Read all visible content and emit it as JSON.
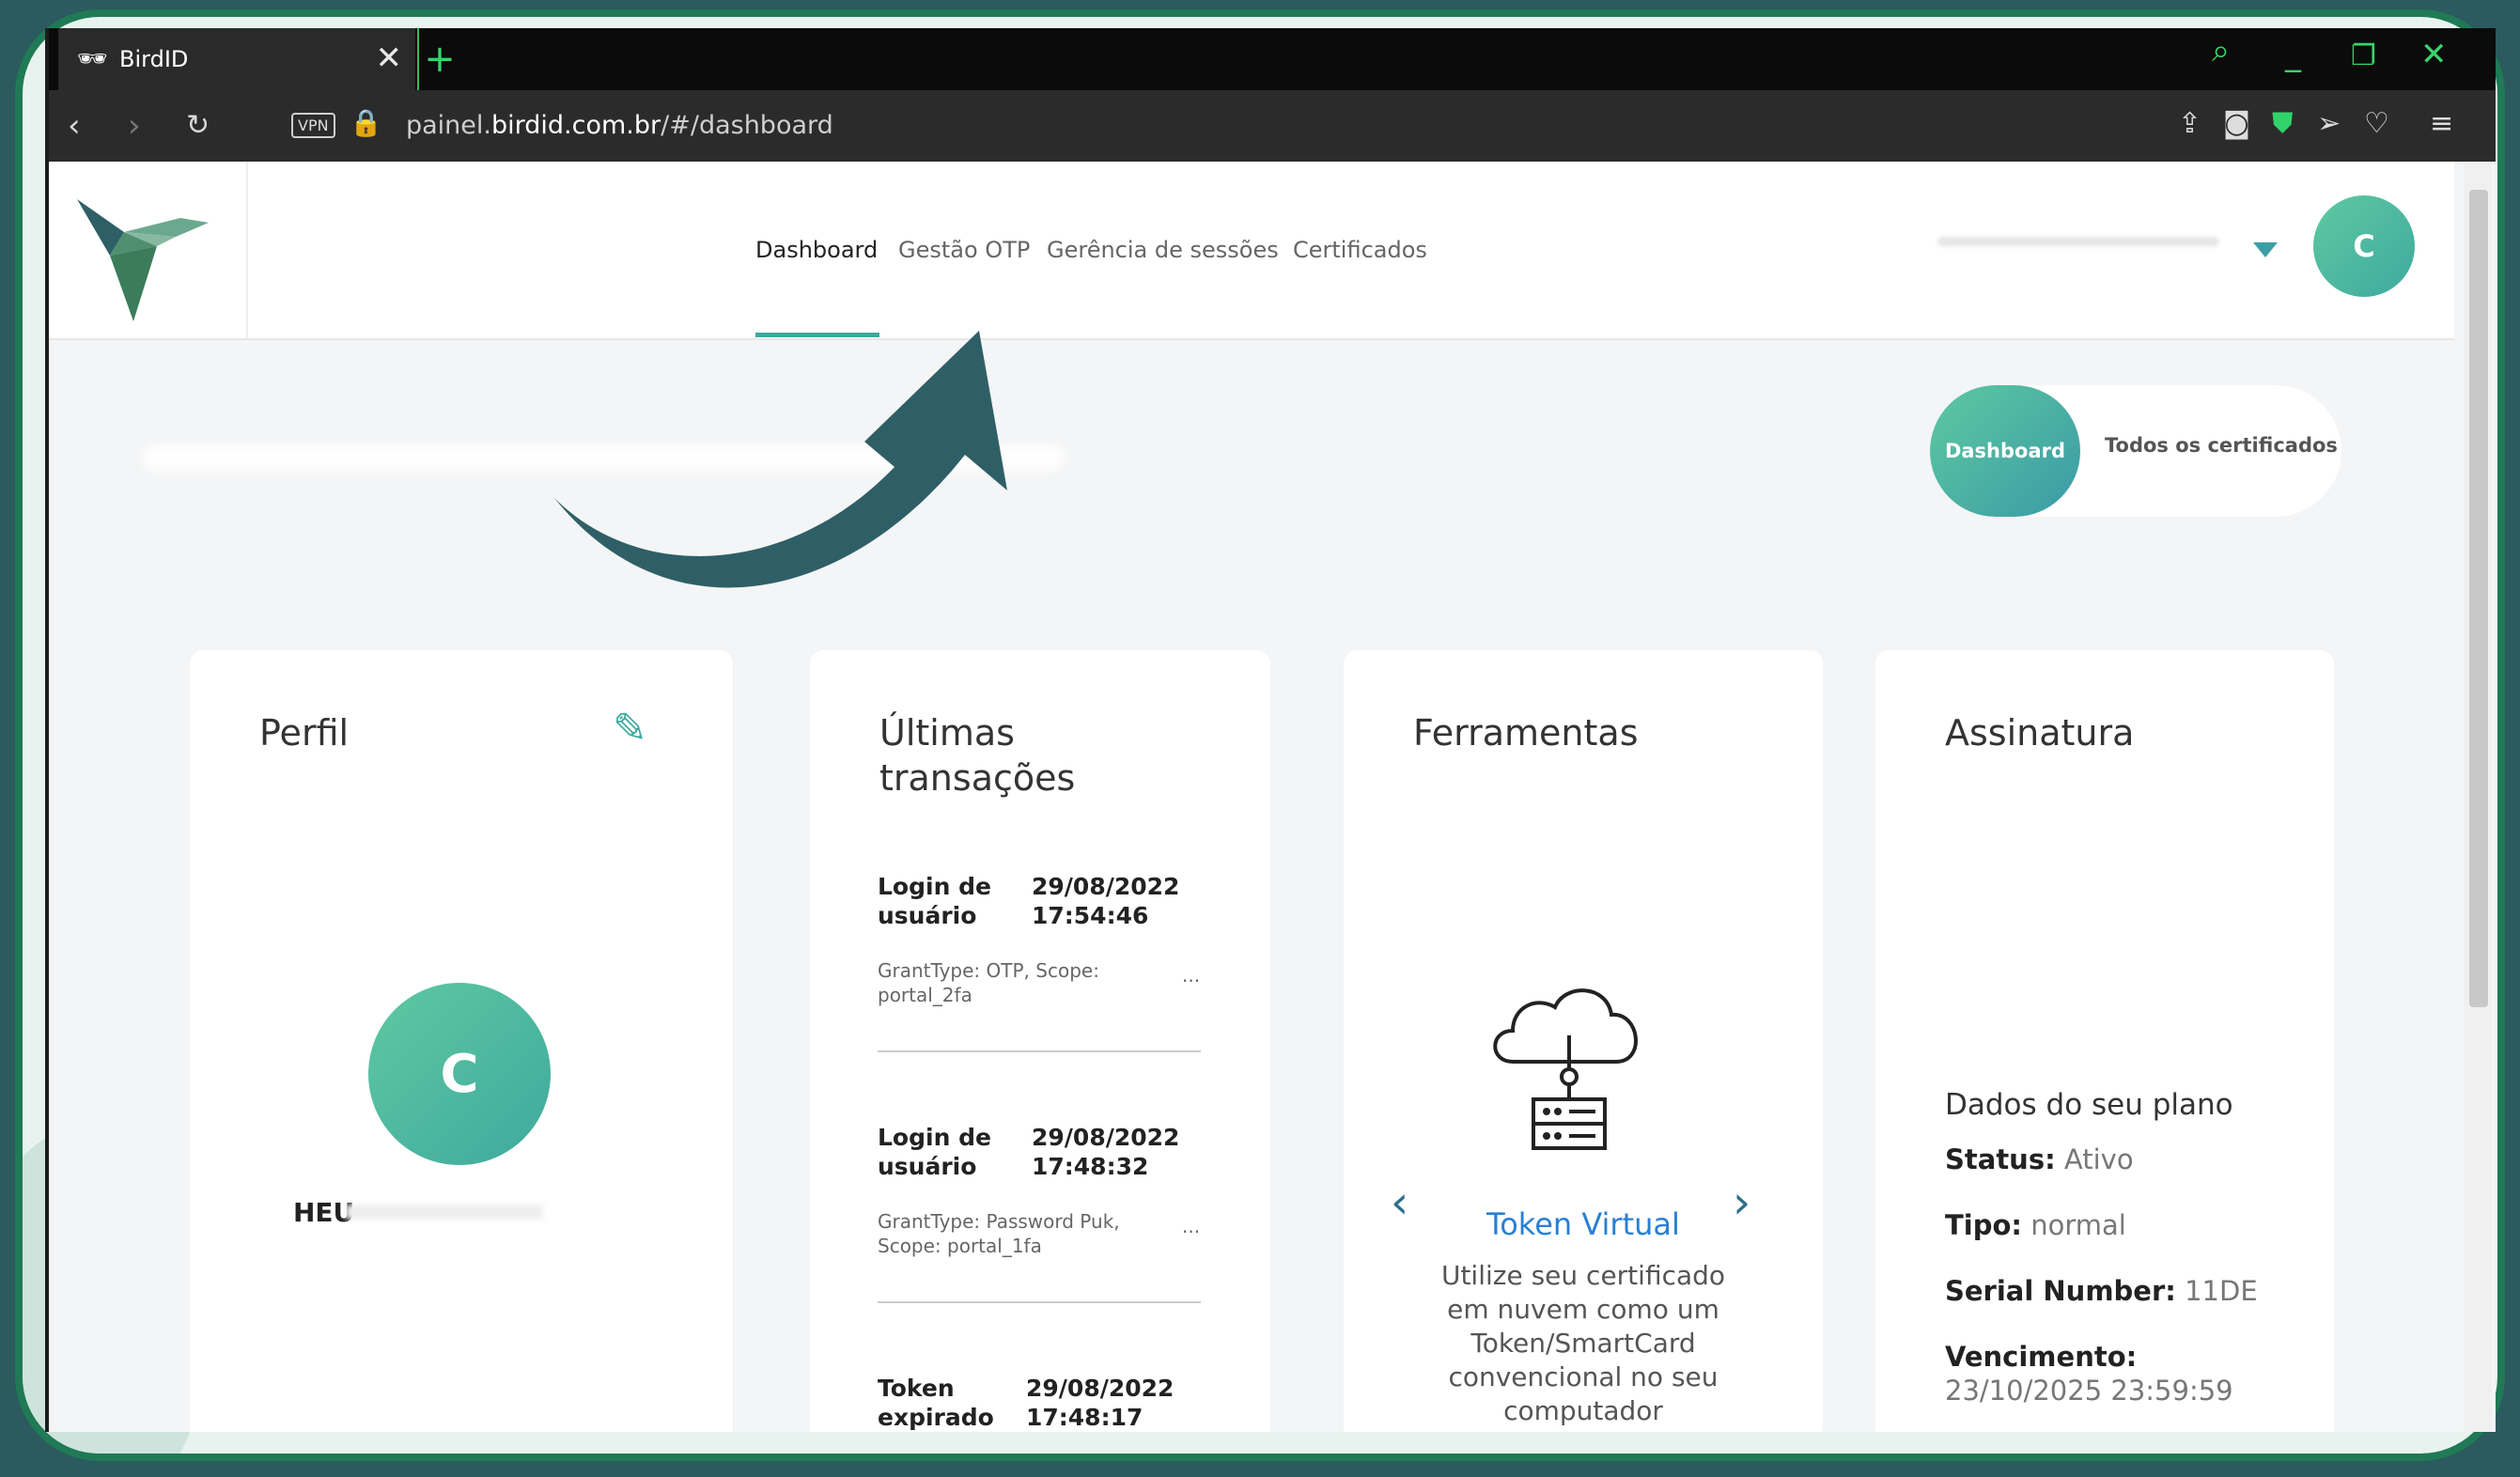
{
  "browser": {
    "tab_title": "BirdID",
    "new_tab": "+",
    "close": "✕",
    "vpn": "VPN",
    "url_pre": "painel.",
    "url_domain": "birdid.com.br",
    "url_path": "/#/dashboard"
  },
  "nav": {
    "items": [
      "Dashboard",
      "Gestão OTP",
      "Gerência de sessões",
      "Certificados"
    ],
    "active": "Dashboard",
    "avatar_letter": "C"
  },
  "toggle": {
    "on": "Dashboard",
    "off": "Todos os certificados"
  },
  "perfil": {
    "title": "Perfil",
    "avatar_letter": "C",
    "name_visible": "HEU"
  },
  "transacoes": {
    "title_line1": "Últimas",
    "title_line2": "transações",
    "rows": [
      {
        "type_l1": "Login de",
        "type_l2": "usuário",
        "date": "29/08/2022",
        "time": "17:54:46",
        "desc_l1": "GrantType: OTP, Scope:",
        "desc_l2": "portal_2fa",
        "more": "..."
      },
      {
        "type_l1": "Login de",
        "type_l2": "usuário",
        "date": "29/08/2022",
        "time": "17:48:32",
        "desc_l1": "GrantType: Password Puk,",
        "desc_l2": "Scope: portal_1fa",
        "more": "..."
      },
      {
        "type_l1": "Token",
        "type_l2": "expirado",
        "date": "29/08/2022",
        "time": "17:48:17"
      }
    ]
  },
  "ferramentas": {
    "title": "Ferramentas",
    "tool_name": "Token Virtual",
    "tool_desc": "Utilize seu certificado em nuvem como um Token/SmartCard convencional no seu computador",
    "prev": "‹",
    "next": "›"
  },
  "assinatura": {
    "title": "Assinatura",
    "plan_heading": "Dados do seu plano",
    "status_label": "Status:",
    "status_value": "Ativo",
    "tipo_label": "Tipo:",
    "tipo_value": "normal",
    "serial_label": "Serial Number:",
    "serial_value": "11DE",
    "venc_label": "Vencimento:",
    "venc_value": "23/10/2025 23:59:59"
  },
  "colors": {
    "accent": "#3fa99f",
    "arrow": "#2f5f66",
    "frame": "#1f7a55",
    "link": "#2a7fd4"
  }
}
